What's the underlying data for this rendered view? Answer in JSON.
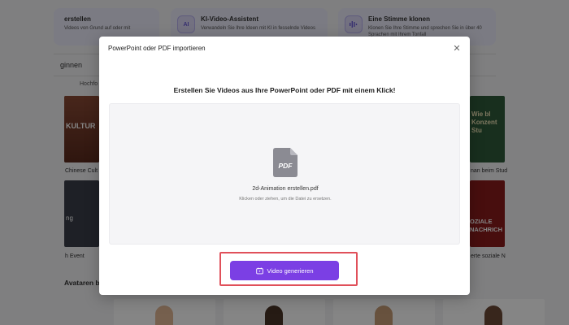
{
  "background": {
    "feature_cards": [
      {
        "title": "erstellen",
        "desc": "Videos von Grund auf oder mit"
      },
      {
        "icon": "AI",
        "title": "KI-Video-Assistent",
        "desc": "Verwandeln Sie Ihre Ideen mit KI in fesselnde Videos"
      },
      {
        "icon": "voice",
        "title": "Eine Stimme klonen",
        "desc": "Klonen Sie Ihre Stimme und sprechen Sie in über 40 Sprachen mit Ihrem Tonfall"
      }
    ],
    "nav_link": "ginnen",
    "filter_label": "Hochfo",
    "thumbs": [
      {
        "text": "KULTUR",
        "caption": "Chinese Cult"
      },
      {
        "text": "Wie bl Konzent Stu",
        "caption": "nan beim Stud"
      },
      {
        "text": "ng",
        "caption": "h Event"
      },
      {
        "text": "OZIALE NACHRICH",
        "caption": "erte soziale N"
      }
    ],
    "section_label": "Avataren b"
  },
  "modal": {
    "title": "PowerPoint oder PDF importieren",
    "headline": "Erstellen Sie Videos aus Ihre PowerPoint oder PDF mit einem Klick!",
    "file_icon_label": "PDF",
    "file_name": "2d-Animation erstellen.pdf",
    "file_hint": "Klicken oder ziehen, um die Datei zu ersetzen.",
    "generate_button": "Video generieren"
  },
  "colors": {
    "accent": "#7b3fe4",
    "highlight": "#e0505a"
  }
}
